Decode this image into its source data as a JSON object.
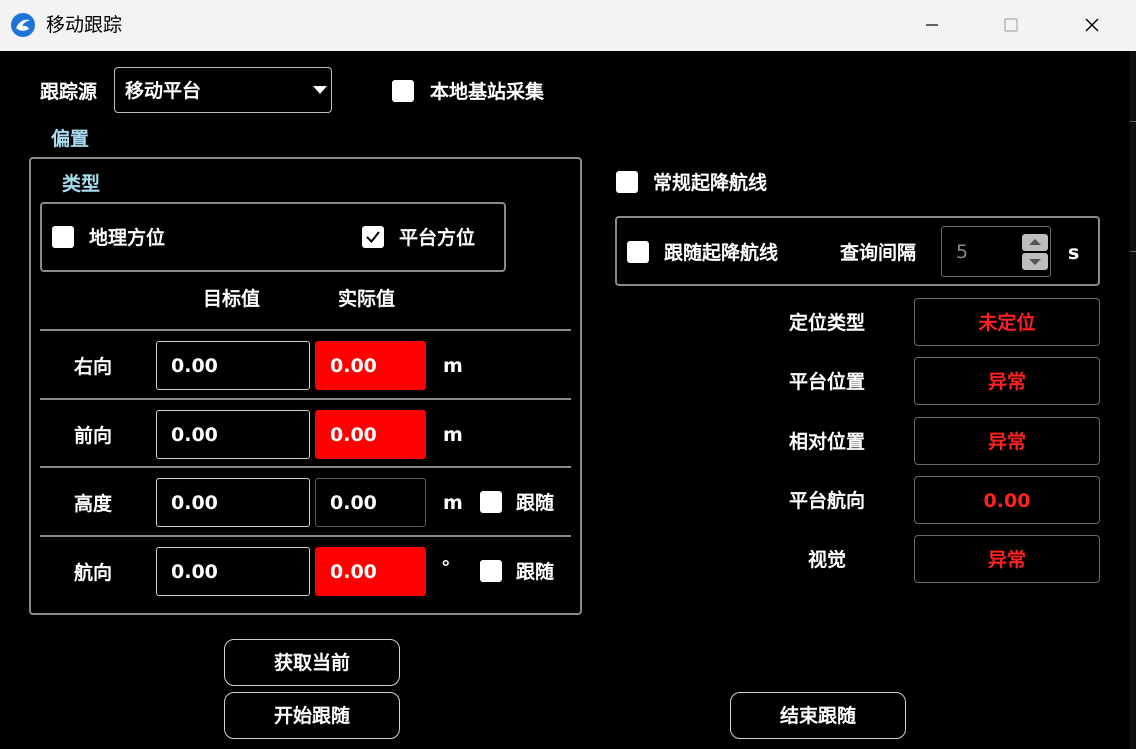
{
  "window": {
    "title": "移动跟踪",
    "icons": {
      "app": "app-logo-icon",
      "minimize": "minimize-icon",
      "maximize": "maximize-icon",
      "close": "close-icon"
    }
  },
  "source": {
    "label": "跟踪源",
    "value": "移动平台"
  },
  "local_station": {
    "label": "本地基站采集",
    "checked": false
  },
  "offset": {
    "title": "偏置",
    "type_title": "类型",
    "geo_bearing": {
      "label": "地理方位",
      "checked": false
    },
    "platform_bearing": {
      "label": "平台方位",
      "checked": true
    },
    "col_target": "目标值",
    "col_actual": "实际值",
    "follow_label": "跟随",
    "rows": [
      {
        "label": "右向",
        "target": "0.00",
        "actual": "0.00",
        "unit": "m"
      },
      {
        "label": "前向",
        "target": "0.00",
        "actual": "0.00",
        "unit": "m"
      },
      {
        "label": "高度",
        "target": "0.00",
        "actual": "0.00",
        "unit": "m"
      },
      {
        "label": "航向",
        "target": "0.00",
        "actual": "0.00",
        "unit": "°"
      }
    ]
  },
  "routes": {
    "regular": {
      "label": "常规起降航线",
      "checked": false
    },
    "follow": {
      "label": "跟随起降航线",
      "checked": false
    },
    "interval_label": "查询间隔",
    "interval_value": "5",
    "interval_unit": "s"
  },
  "status": {
    "items": [
      {
        "label": "定位类型",
        "value": "未定位"
      },
      {
        "label": "平台位置",
        "value": "异常"
      },
      {
        "label": "相对位置",
        "value": "异常"
      },
      {
        "label": "平台航向",
        "value": "0.00"
      },
      {
        "label": "视觉",
        "value": "异常"
      }
    ],
    "value_color": "#ff2020"
  },
  "buttons": {
    "get_current": "获取当前",
    "start_follow": "开始跟随",
    "end_follow": "结束跟随"
  },
  "colors": {
    "alert_fill": "#ff0000",
    "group_title": "#a9dcf0",
    "background": "#000000"
  }
}
